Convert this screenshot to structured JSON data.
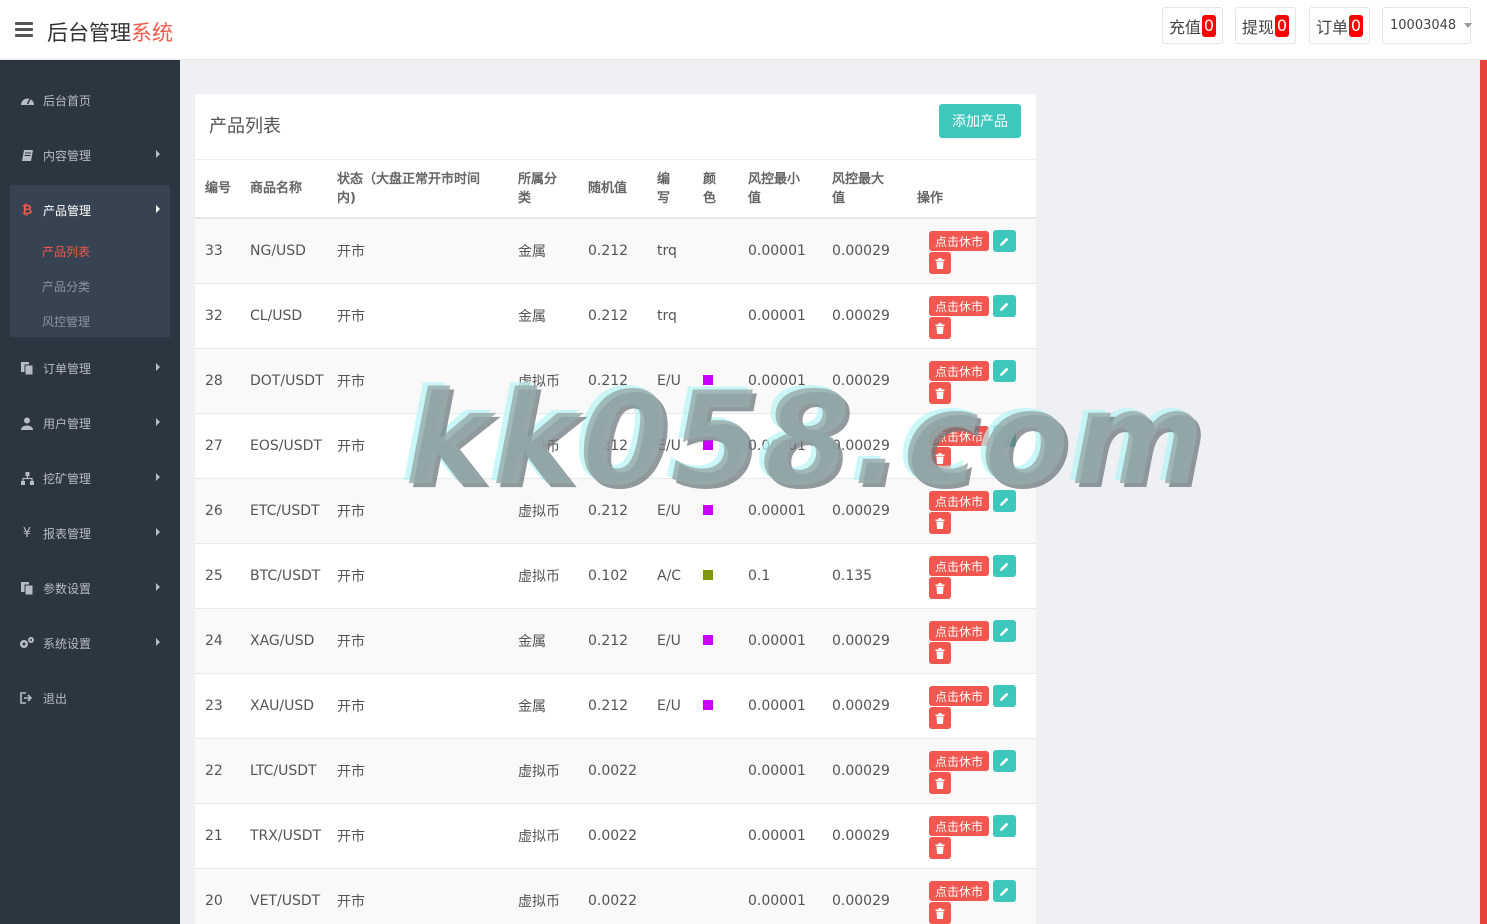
{
  "header": {
    "brand_main": "后台管理",
    "brand_accent": "系统",
    "recharge": {
      "label": "充值",
      "count": "0"
    },
    "withdraw": {
      "label": "提现",
      "count": "0"
    },
    "orders": {
      "label": "订单",
      "count": "0"
    },
    "user_id": "10003048"
  },
  "sidebar": {
    "items": [
      {
        "label": "后台首页",
        "icon": "dashboard-icon"
      },
      {
        "label": "内容管理",
        "icon": "book-icon"
      },
      {
        "label": "产品管理",
        "icon": "bitcoin-icon"
      },
      {
        "label": "订单管理",
        "icon": "copy-icon"
      },
      {
        "label": "用户管理",
        "icon": "user-icon"
      },
      {
        "label": "挖矿管理",
        "icon": "sitemap-icon"
      },
      {
        "label": "报表管理",
        "icon": "yen-icon"
      },
      {
        "label": "参数设置",
        "icon": "copy-icon"
      },
      {
        "label": "系统设置",
        "icon": "gears-icon"
      },
      {
        "label": "退出",
        "icon": "sign-out-icon"
      }
    ],
    "sub_items": [
      "产品列表",
      "产品分类",
      "风控管理"
    ]
  },
  "panel": {
    "title": "产品列表",
    "add_button": "添加产品",
    "columns": [
      "编号",
      "商品名称",
      "状态（大盘正常开市时间内)",
      "所属分类",
      "随机值",
      "编写",
      "颜色",
      "风控最小值",
      "风控最大值",
      "操作"
    ],
    "halt_label": "点击休市",
    "rows": [
      {
        "id": "33",
        "name": "NG/USD",
        "status": "开市",
        "category": "金属",
        "random": "0.212",
        "code": "trq",
        "color": "",
        "min": "0.00001",
        "max": "0.00029"
      },
      {
        "id": "32",
        "name": "CL/USD",
        "status": "开市",
        "category": "金属",
        "random": "0.212",
        "code": "trq",
        "color": "",
        "min": "0.00001",
        "max": "0.00029"
      },
      {
        "id": "28",
        "name": "DOT/USDT",
        "status": "开市",
        "category": "虚拟币",
        "random": "0.212",
        "code": "E/U",
        "color": "#cc00ff",
        "min": "0.00001",
        "max": "0.00029"
      },
      {
        "id": "27",
        "name": "EOS/USDT",
        "status": "开市",
        "category": "虚拟币",
        "random": "0.212",
        "code": "E/U",
        "color": "#cc00ff",
        "min": "0.00001",
        "max": "0.00029"
      },
      {
        "id": "26",
        "name": "ETC/USDT",
        "status": "开市",
        "category": "虚拟币",
        "random": "0.212",
        "code": "E/U",
        "color": "#cc00ff",
        "min": "0.00001",
        "max": "0.00029"
      },
      {
        "id": "25",
        "name": "BTC/USDT",
        "status": "开市",
        "category": "虚拟币",
        "random": "0.102",
        "code": "A/C",
        "color": "#7f9900",
        "min": "0.1",
        "max": "0.135"
      },
      {
        "id": "24",
        "name": "XAG/USD",
        "status": "开市",
        "category": "金属",
        "random": "0.212",
        "code": "E/U",
        "color": "#cc00ff",
        "min": "0.00001",
        "max": "0.00029"
      },
      {
        "id": "23",
        "name": "XAU/USD",
        "status": "开市",
        "category": "金属",
        "random": "0.212",
        "code": "E/U",
        "color": "#cc00ff",
        "min": "0.00001",
        "max": "0.00029"
      },
      {
        "id": "22",
        "name": "LTC/USDT",
        "status": "开市",
        "category": "虚拟币",
        "random": "0.0022",
        "code": "",
        "color": "",
        "min": "0.00001",
        "max": "0.00029"
      },
      {
        "id": "21",
        "name": "TRX/USDT",
        "status": "开市",
        "category": "虚拟币",
        "random": "0.0022",
        "code": "",
        "color": "",
        "min": "0.00001",
        "max": "0.00029"
      },
      {
        "id": "20",
        "name": "VET/USDT",
        "status": "开市",
        "category": "虚拟币",
        "random": "0.0022",
        "code": "",
        "color": "",
        "min": "0.00001",
        "max": "0.00029"
      }
    ]
  },
  "watermark": "kk058.com"
}
